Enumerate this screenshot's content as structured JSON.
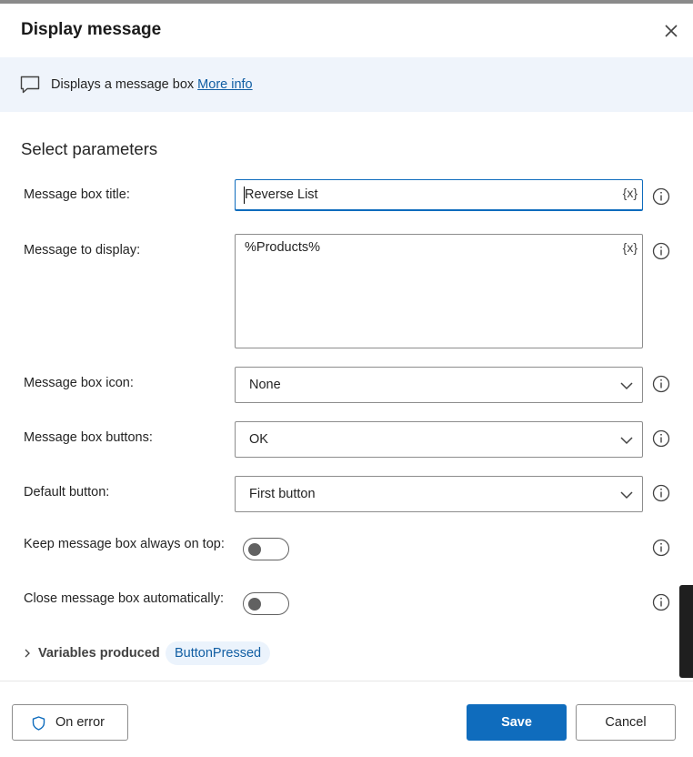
{
  "dialog": {
    "title": "Display message",
    "close_icon": "close-icon"
  },
  "info_bar": {
    "icon": "message-icon",
    "description": "Displays a message box",
    "more_info": "More info"
  },
  "section_title": "Select parameters",
  "fields": {
    "title": {
      "label": "Message box title:",
      "value": "Reverse List",
      "var_button": "{x}"
    },
    "message": {
      "label": "Message to display:",
      "value": "%Products%",
      "var_button": "{x}"
    },
    "icon": {
      "label": "Message box icon:",
      "value": "None"
    },
    "buttons": {
      "label": "Message box buttons:",
      "value": "OK"
    },
    "default_button": {
      "label": "Default button:",
      "value": "First button"
    },
    "always_on_top": {
      "label": "Keep message box always on top:",
      "on": false
    },
    "close_auto": {
      "label": "Close message box automatically:",
      "on": false
    }
  },
  "variables": {
    "label": "Variables produced",
    "chips": [
      "ButtonPressed"
    ]
  },
  "footer": {
    "on_error": "On error",
    "save": "Save",
    "cancel": "Cancel"
  },
  "colors": {
    "accent": "#0f6cbd",
    "info_bar_bg": "#eff4fb",
    "chip_bg": "#ebf3fc"
  }
}
